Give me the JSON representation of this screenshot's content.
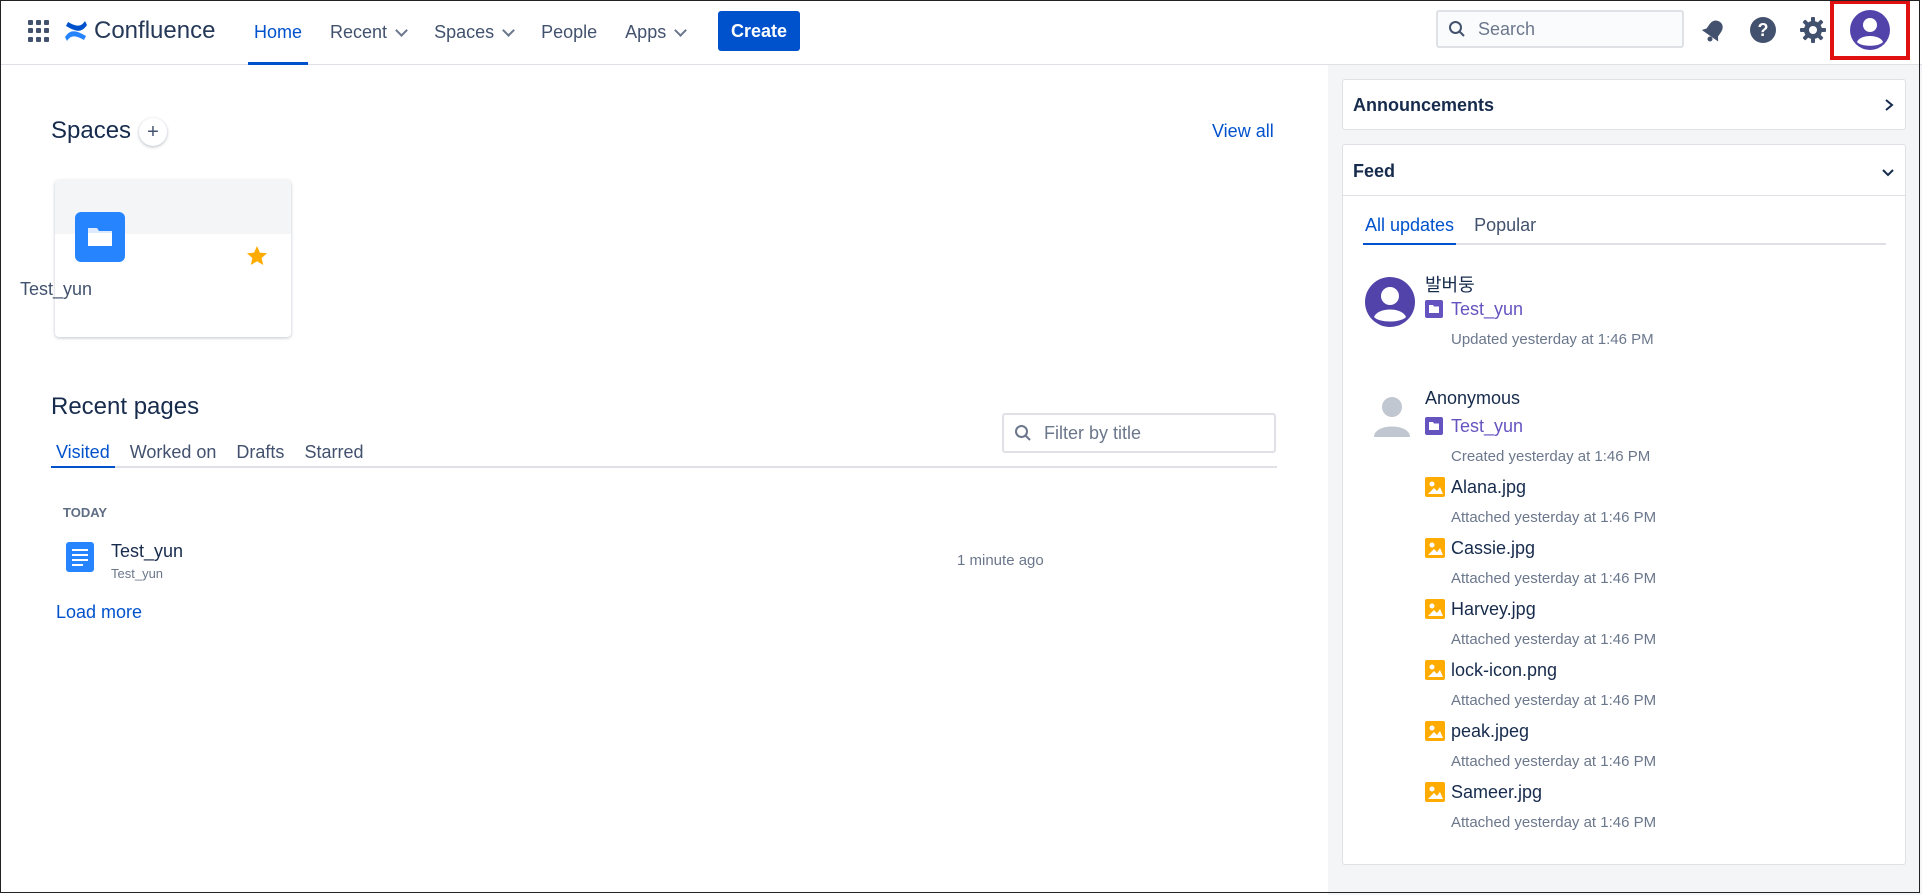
{
  "app": {
    "name": "Confluence"
  },
  "nav": {
    "home": "Home",
    "recent": "Recent",
    "spaces": "Spaces",
    "people": "People",
    "apps": "Apps",
    "create": "Create"
  },
  "search": {
    "placeholder": "Search"
  },
  "colors": {
    "brand": "#0052CC",
    "highlight": "#E01010",
    "avatar": "#5243AA",
    "attachment": "#FFAB00"
  },
  "spaces_section": {
    "title": "Spaces",
    "view_all": "View all",
    "cards": [
      {
        "name": "Test_yun",
        "starred": true
      }
    ]
  },
  "recent_pages": {
    "title": "Recent pages",
    "filter_placeholder": "Filter by title",
    "tabs": [
      "Visited",
      "Worked on",
      "Drafts",
      "Starred"
    ],
    "group_label": "TODAY",
    "items": [
      {
        "title": "Test_yun",
        "space": "Test_yun",
        "time": "1 minute ago"
      }
    ],
    "load_more": "Load more"
  },
  "sidebar": {
    "announcements": "Announcements",
    "feed": {
      "title": "Feed",
      "tabs": [
        "All updates",
        "Popular"
      ],
      "entries": [
        {
          "user": "발버둥",
          "space": "Test_yun",
          "meta": "Updated yesterday at 1:46 PM"
        },
        {
          "user": "Anonymous",
          "space": "Test_yun",
          "meta": "Created yesterday at 1:46 PM",
          "attachments": [
            {
              "name": "Alana.jpg",
              "meta": "Attached yesterday at 1:46 PM"
            },
            {
              "name": "Cassie.jpg",
              "meta": "Attached yesterday at 1:46 PM"
            },
            {
              "name": "Harvey.jpg",
              "meta": "Attached yesterday at 1:46 PM"
            },
            {
              "name": "lock-icon.png",
              "meta": "Attached yesterday at 1:46 PM"
            },
            {
              "name": "peak.jpeg",
              "meta": "Attached yesterday at 1:46 PM"
            },
            {
              "name": "Sameer.jpg",
              "meta": "Attached yesterday at 1:46 PM"
            }
          ]
        }
      ]
    }
  }
}
